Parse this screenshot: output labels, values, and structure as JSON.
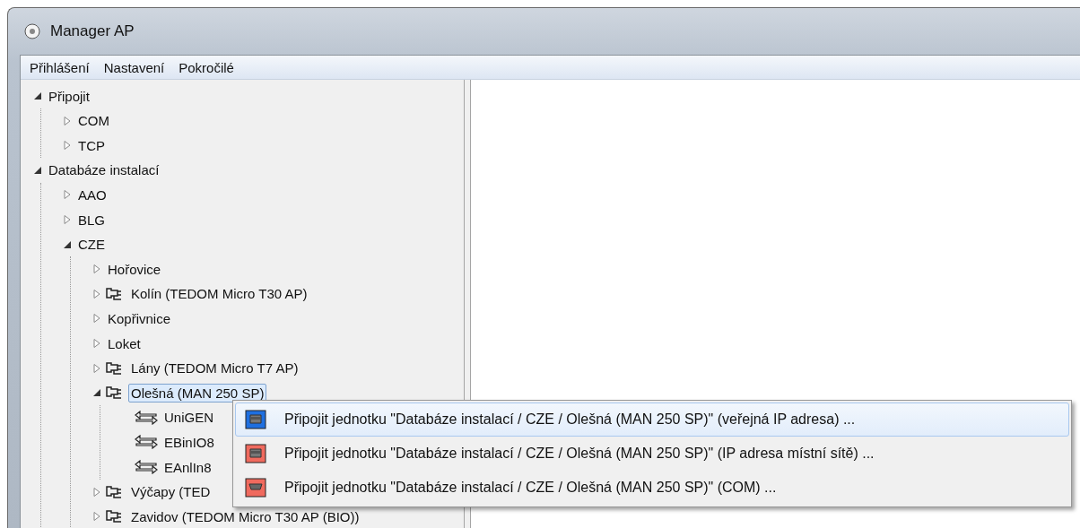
{
  "window": {
    "title": "Manager AP"
  },
  "menu_bar": [
    {
      "label": "Přihlášení"
    },
    {
      "label": "Nastavení"
    },
    {
      "label": "Pokročilé"
    }
  ],
  "tree": [
    {
      "label": "Připojit",
      "expanded": true,
      "selected": false,
      "children": [
        {
          "label": "COM",
          "expanded": false,
          "selected": false
        },
        {
          "label": "TCP",
          "expanded": false,
          "selected": false
        }
      ]
    },
    {
      "label": "Databáze instalací",
      "expanded": true,
      "selected": false,
      "children": [
        {
          "label": "AAO",
          "expanded": false,
          "selected": false
        },
        {
          "label": "BLG",
          "expanded": false,
          "selected": false
        },
        {
          "label": "CZE",
          "expanded": true,
          "selected": false,
          "children": [
            {
              "label": "Hořovice",
              "expanded": false,
              "selected": false
            },
            {
              "label": "Kolín (TEDOM Micro T30 AP)",
              "kind": "device",
              "expanded": false,
              "selected": false
            },
            {
              "label": "Kopřivnice",
              "expanded": false,
              "selected": false
            },
            {
              "label": "Loket",
              "expanded": false,
              "selected": false
            },
            {
              "label": "Lány (TEDOM Micro T7 AP)",
              "kind": "device",
              "expanded": false,
              "selected": false
            },
            {
              "label": "Olešná (MAN 250 SP)",
              "kind": "device",
              "expanded": true,
              "selected": true,
              "children": [
                {
                  "label": "UniGEN",
                  "kind": "unit",
                  "selected": false
                },
                {
                  "label": "EBinIO8",
                  "kind": "unit",
                  "selected": false
                },
                {
                  "label": "EAnlIn8",
                  "kind": "unit",
                  "selected": false
                }
              ]
            },
            {
              "label": "Výčapy (TED",
              "kind": "device",
              "expanded": false,
              "selected": false
            },
            {
              "label": "Zavidov (TEDOM Micro T30 AP (BIO))",
              "kind": "device",
              "expanded": false,
              "selected": false
            }
          ]
        }
      ]
    }
  ],
  "context_menu": [
    {
      "label": "Připojit jednotku \"Databáze instalací / CZE / Olešná (MAN 250 SP)\" (veřejná IP adresa) ...",
      "kind": "network",
      "color": "#1e6fe0",
      "selected": true
    },
    {
      "label": "Připojit jednotku \"Databáze instalací / CZE / Olešná (MAN 250 SP)\" (IP adresa místní sítě) ...",
      "kind": "network",
      "color": "#f06a5e",
      "selected": false
    },
    {
      "label": "Připojit jednotku \"Databáze instalací / CZE / Olešná (MAN 250 SP)\" (COM) ...",
      "kind": "serial",
      "color": "#f06a5e",
      "selected": false
    }
  ]
}
